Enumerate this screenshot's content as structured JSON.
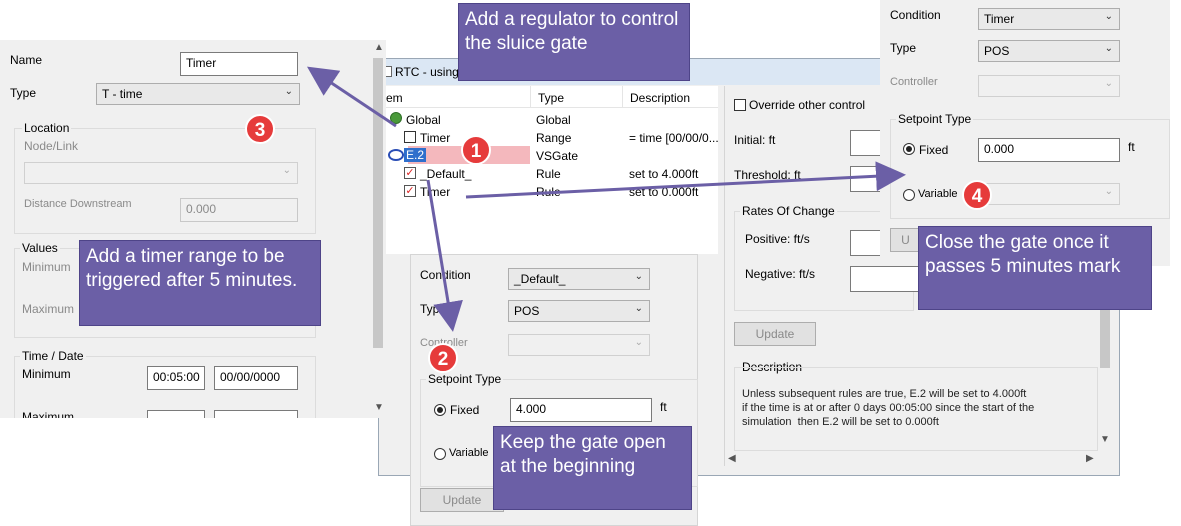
{
  "rtc_window": {
    "title": "RTC -  using r",
    "columns": [
      "em",
      "Type",
      "Description"
    ],
    "rows": [
      {
        "name": "Global",
        "type": "Global",
        "description": ""
      },
      {
        "name": "Timer",
        "type": "Range",
        "description": "= time [00/00/0..."
      },
      {
        "name": "E.2",
        "type": "VSGate",
        "description": ""
      },
      {
        "name": "_Default_",
        "type": "Rule",
        "description": "set to 4.000ft"
      },
      {
        "name": "Timer",
        "type": "Rule",
        "description": "set to 0.000ft"
      }
    ],
    "override_label": "Override other control",
    "initial_label": "Initial: ft",
    "threshold_label": "Threshold: ft",
    "rates_title": "Rates Of Change",
    "positive_label": "Positive: ft/s",
    "negative_label": "Negative: ft/s",
    "update_label": "Update",
    "description_title": "Description",
    "description_text": "Unless subsequent rules are true, E.2 will be set to 4.000ft\nif the time is at or after 0 days 00:05:00 since the start of the\nsimulation  then E.2 will be set to 0.000ft"
  },
  "left_panel": {
    "name_label": "Name",
    "name_value": "Timer",
    "type_label": "Type",
    "type_value": "T - time",
    "location_title": "Location",
    "node_link_label": "Node/Link",
    "distance_label": "Distance Downstream",
    "distance_value": "0.000",
    "values_title": "Values",
    "minimum_label": "Minimum",
    "maximum_label": "Maximum",
    "timedate_title": "Time / Date",
    "td_minimum_label": "Minimum",
    "td_min_time": "00:05:00",
    "td_min_date": "00/00/0000",
    "td_maximum_label": "Maximum"
  },
  "middle_panel": {
    "condition_label": "Condition",
    "condition_value": "_Default_",
    "type_label": "Type",
    "type_value": "POS",
    "controller_label": "Controller",
    "setpoint_title": "Setpoint Type",
    "fixed_label": "Fixed",
    "fixed_value": "4.000",
    "unit": "ft",
    "variable_label": "Variable",
    "update_label": "Update"
  },
  "right_panel": {
    "condition_label": "Condition",
    "condition_value": "Timer",
    "type_label": "Type",
    "type_value": "POS",
    "controller_label": "Controller",
    "setpoint_title": "Setpoint Type",
    "fixed_label": "Fixed",
    "fixed_value": "0.000",
    "unit": "ft",
    "variable_label": "Variable"
  },
  "callouts": {
    "regulator": "Add a regulator to control the sluice gate",
    "timer": "Add a timer range to be triggered after 5 minutes.",
    "open": "Keep the gate open at the beginning",
    "close": "Close the gate once it passes 5 minutes mark"
  },
  "badges": [
    "1",
    "2",
    "3",
    "4"
  ],
  "colors": {
    "callout_bg": "#6b5fa6",
    "badge_bg": "#e63b3b",
    "arrow": "#6b5fa6",
    "selection": "#f4b8bd",
    "window_title": "#dbe7f4"
  }
}
